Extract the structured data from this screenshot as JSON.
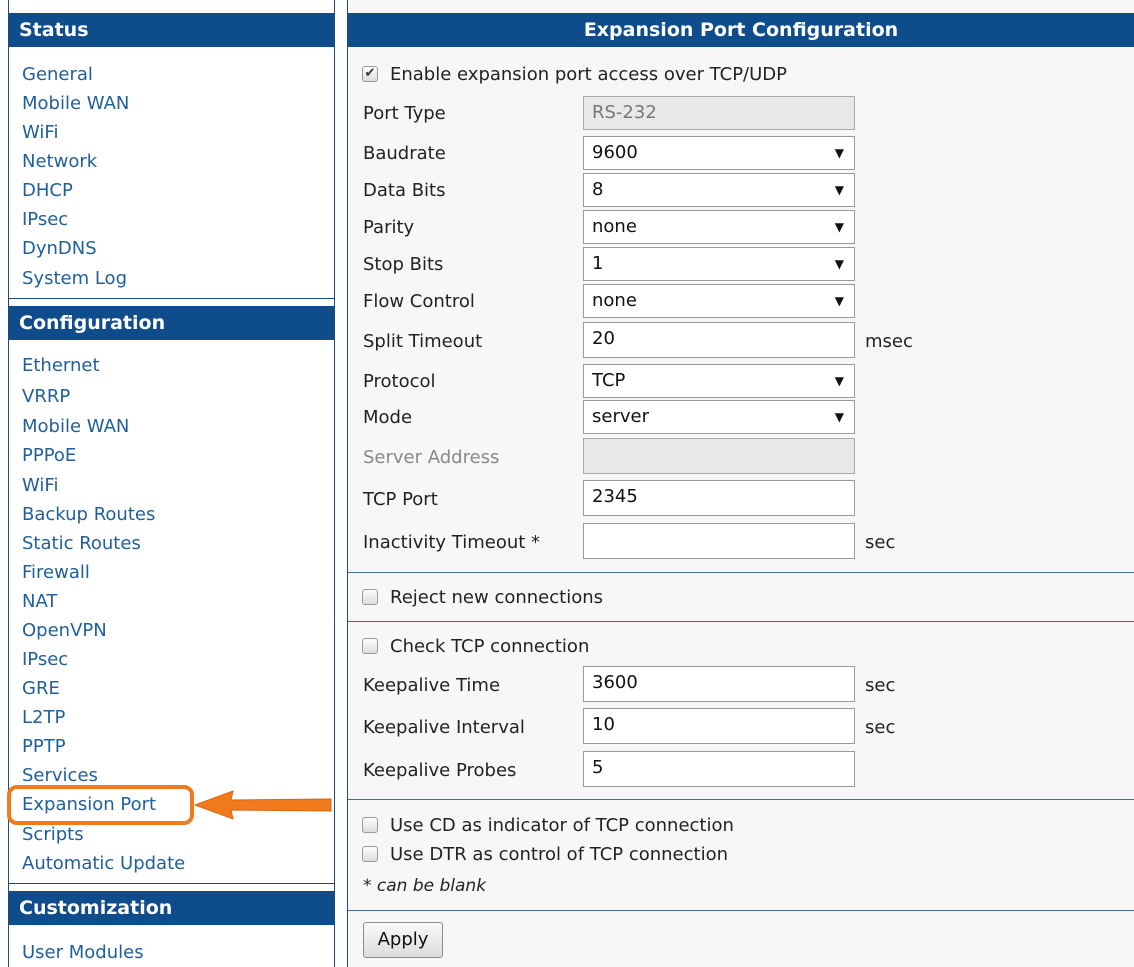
{
  "sidebar": {
    "status_title": "Status",
    "status_items": [
      "General",
      "Mobile WAN",
      "WiFi",
      "Network",
      "DHCP",
      "IPsec",
      "DynDNS",
      "System Log"
    ],
    "config_title": "Configuration",
    "config_items": [
      "Ethernet",
      "VRRP",
      "Mobile WAN",
      "PPPoE",
      "WiFi",
      "Backup Routes",
      "Static Routes",
      "Firewall",
      "NAT",
      "OpenVPN",
      "IPsec",
      "GRE",
      "L2TP",
      "PPTP",
      "Services",
      "Expansion Port",
      "Scripts",
      "Automatic Update"
    ],
    "custom_title": "Customization",
    "custom_items": [
      "User Modules"
    ],
    "selected": "Expansion Port"
  },
  "main": {
    "title": "Expansion Port Configuration",
    "enable_label": "Enable expansion port access over TCP/UDP",
    "enable_checked": true,
    "fields": {
      "port_type": {
        "label": "Port Type",
        "value": "RS-232"
      },
      "baudrate": {
        "label": "Baudrate",
        "value": "9600"
      },
      "data_bits": {
        "label": "Data Bits",
        "value": "8"
      },
      "parity": {
        "label": "Parity",
        "value": "none"
      },
      "stop_bits": {
        "label": "Stop Bits",
        "value": "1"
      },
      "flow_control": {
        "label": "Flow Control",
        "value": "none"
      },
      "split_timeout": {
        "label": "Split Timeout",
        "value": "20",
        "unit": "msec"
      },
      "protocol": {
        "label": "Protocol",
        "value": "TCP"
      },
      "mode": {
        "label": "Mode",
        "value": "server"
      },
      "server_address": {
        "label": "Server Address",
        "value": ""
      },
      "tcp_port": {
        "label": "TCP Port",
        "value": "2345"
      },
      "inactivity_timeout": {
        "label": "Inactivity Timeout *",
        "value": "",
        "unit": "sec"
      }
    },
    "reject_label": "Reject new connections",
    "check_tcp_label": "Check TCP connection",
    "keepalive": {
      "time": {
        "label": "Keepalive Time",
        "value": "3600",
        "unit": "sec"
      },
      "interval": {
        "label": "Keepalive Interval",
        "value": "10",
        "unit": "sec"
      },
      "probes": {
        "label": "Keepalive Probes",
        "value": "5"
      }
    },
    "cd_label": "Use CD as indicator of TCP connection",
    "dtr_label": "Use DTR as control of TCP connection",
    "blank_note": "* can be blank",
    "apply_label": "Apply"
  },
  "colors": {
    "header_bg": "#0e4c8c",
    "link": "#1f5f9a",
    "highlight": "#f07a1c"
  }
}
